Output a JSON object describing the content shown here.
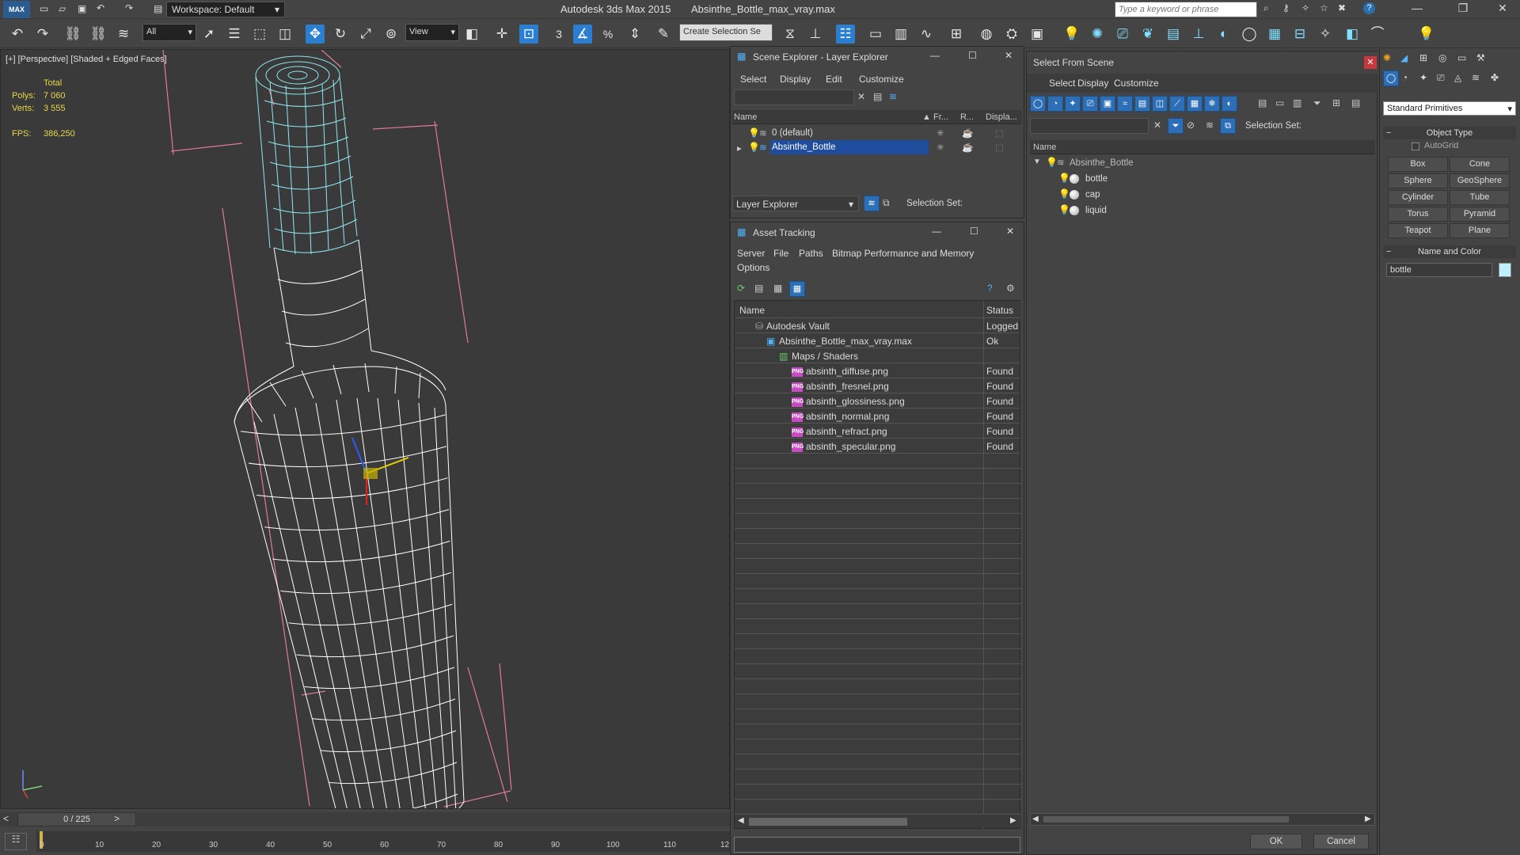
{
  "app": {
    "title": "Autodesk 3ds Max  2015",
    "file": "Absinthe_Bottle_max_vray.max",
    "logo": "MAX",
    "workspace": "Workspace: Default",
    "search_placeholder": "Type a keyword or phrase",
    "minimize": "—",
    "restore": "❐",
    "close": "✕"
  },
  "toolbar": {
    "selection_filter": "All",
    "ref_coord": "View",
    "named_selection": "Create Selection Se",
    "snap_label": "3",
    "percent_label": "%"
  },
  "viewport": {
    "label": "[+] [Perspective] [Shaded + Edged Faces]",
    "stats": {
      "total_label": "Total",
      "polys_label": "Polys:",
      "polys_value": "7 060",
      "verts_label": "Verts:",
      "verts_value": "3 555",
      "fps_label": "FPS:",
      "fps_value": "386,250"
    }
  },
  "timeline": {
    "position": "0 / 225",
    "prev": "<",
    "next": ">",
    "ticks": [
      "0",
      "10",
      "20",
      "30",
      "40",
      "50",
      "60",
      "70",
      "80",
      "90",
      "100",
      "110",
      "12"
    ]
  },
  "scene_explorer": {
    "title": "Scene Explorer - Layer Explorer",
    "menus": [
      "Select",
      "Display",
      "Edit",
      "Customize"
    ],
    "columns": [
      "Name",
      "Fr...",
      "R...",
      "Displa..."
    ],
    "rows": [
      {
        "name": "0 (default)"
      },
      {
        "name": "Absinthe_Bottle"
      }
    ],
    "footer_mode": "Layer Explorer",
    "footer_selection": "Selection Set:"
  },
  "asset_tracking": {
    "title": "Asset Tracking",
    "menus": [
      "Server",
      "File",
      "Paths",
      "Bitmap Performance and Memory",
      "Options"
    ],
    "columns": [
      "Name",
      "Status"
    ],
    "rows": [
      {
        "name": "Autodesk Vault",
        "status": "Logged"
      },
      {
        "name": "Absinthe_Bottle_max_vray.max",
        "status": "Ok"
      },
      {
        "name": "Maps / Shaders",
        "status": ""
      },
      {
        "name": "absinth_diffuse.png",
        "status": "Found"
      },
      {
        "name": "absinth_fresnel.png",
        "status": "Found"
      },
      {
        "name": "absinth_glossiness.png",
        "status": "Found"
      },
      {
        "name": "absinth_normal.png",
        "status": "Found"
      },
      {
        "name": "absinth_refract.png",
        "status": "Found"
      },
      {
        "name": "absinth_specular.png",
        "status": "Found"
      }
    ],
    "png_badge": "PNG"
  },
  "select_from_scene": {
    "title": "Select From Scene",
    "menus": [
      "Select",
      "Display",
      "Customize"
    ],
    "selection_set": "Selection Set:",
    "column": "Name",
    "tree": [
      {
        "name": "Absinthe_Bottle"
      },
      {
        "name": "bottle"
      },
      {
        "name": "cap"
      },
      {
        "name": "liquid"
      }
    ],
    "ok": "OK",
    "cancel": "Cancel"
  },
  "command_panel": {
    "category": "Standard Primitives",
    "object_type_title": "Object Type",
    "autogrid": "AutoGrid",
    "buttons": [
      "Box",
      "Cone",
      "Sphere",
      "GeoSphere",
      "Cylinder",
      "Tube",
      "Torus",
      "Pyramid",
      "Teapot",
      "Plane"
    ],
    "name_color_title": "Name and Color",
    "name_value": "bottle",
    "object_color": "#bff0ff"
  }
}
